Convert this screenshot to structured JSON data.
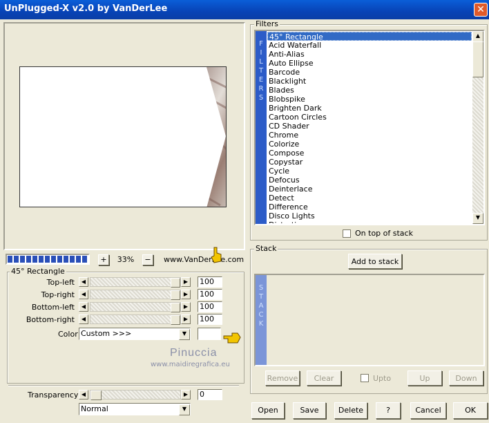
{
  "window": {
    "title": "UnPlugged-X v2.0 by VanDerLee",
    "close_glyph": "✕"
  },
  "preview": {
    "zoom": "33%",
    "zoom_in": "+",
    "zoom_out": "−",
    "website": "www.VanDerLee.com",
    "progress_fraction": 1.0
  },
  "effect": {
    "group_label": "45° Rectangle",
    "sliders": [
      {
        "label": "Top-left",
        "value": "100"
      },
      {
        "label": "Top-right",
        "value": "100"
      },
      {
        "label": "Bottom-left",
        "value": "100"
      },
      {
        "label": "Bottom-right",
        "value": "100"
      }
    ],
    "color_label": "Color",
    "color_select": "Custom >>>",
    "color_swatch": "#ffffff"
  },
  "watermark": {
    "name": "Pinuccia",
    "url": "www.maidiregrafica.eu"
  },
  "transparency": {
    "label": "Transparency",
    "value": "0",
    "blend_mode": "Normal"
  },
  "filters": {
    "group_label": "Filters",
    "side_label": [
      "F",
      "I",
      "L",
      "T",
      "E",
      "R",
      "S"
    ],
    "items": [
      "45° Rectangle",
      "Acid Waterfall",
      "Anti-Alias",
      "Auto Ellipse",
      "Barcode",
      "Blacklight",
      "Blades",
      "Blobspike",
      "Brighten Dark",
      "Cartoon Circles",
      "CD Shader",
      "Chrome",
      "Colorize",
      "Compose",
      "Copystar",
      "Cycle",
      "Defocus",
      "Deinterlace",
      "Detect",
      "Difference",
      "Disco Lights",
      "Distortion"
    ],
    "selected_index": 0,
    "on_top_label": "On top of stack"
  },
  "stack": {
    "group_label": "Stack",
    "add_button": "Add to stack",
    "side_label": [
      "S",
      "T",
      "A",
      "C",
      "K"
    ],
    "remove": "Remove",
    "clear": "Clear",
    "upto": "Upto",
    "up": "Up",
    "down": "Down"
  },
  "bottom_buttons": {
    "open": "Open",
    "save": "Save",
    "delete": "Delete",
    "help": "?",
    "cancel": "Cancel",
    "ok": "OK"
  },
  "icons": {
    "close": "close-icon",
    "scroll_up": "scroll-up-icon",
    "scroll_down": "scroll-down-icon",
    "hand_pointer": "hand-pointer-icon"
  }
}
